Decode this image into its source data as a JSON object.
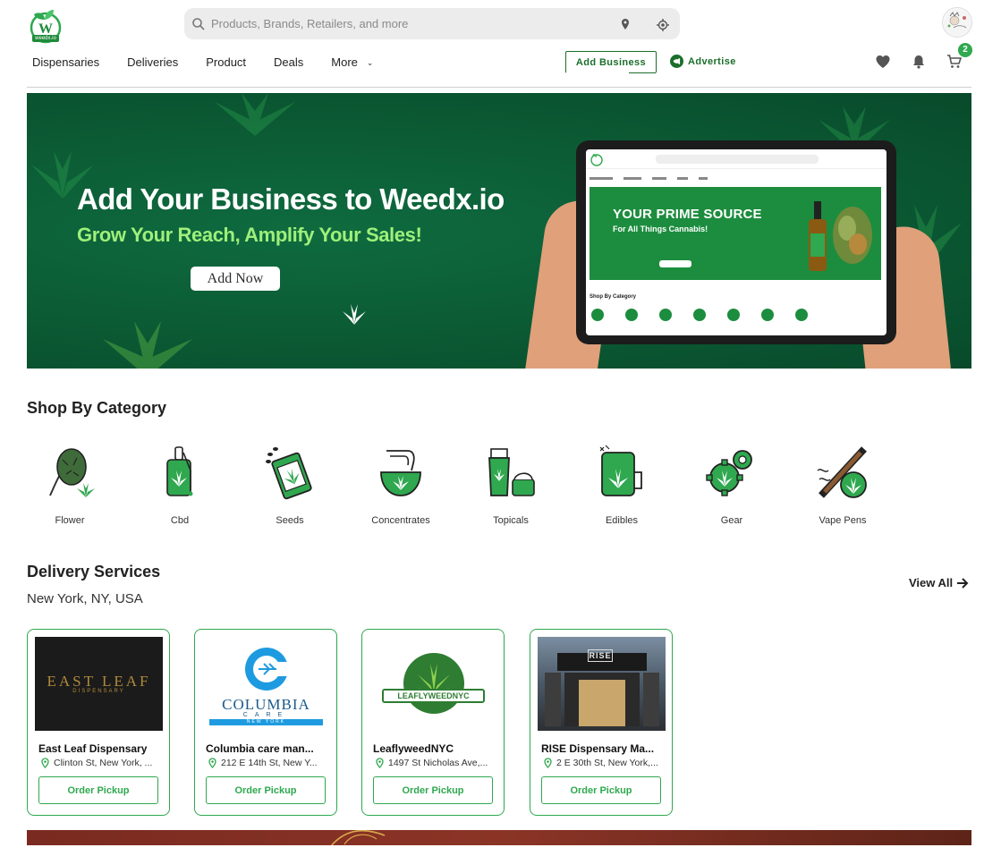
{
  "header": {
    "logo_text": "weedx.io",
    "search_placeholder": "Products, Brands, Retailers, and more",
    "nav": [
      "Dispensaries",
      "Deliveries",
      "Product",
      "Deals",
      "More"
    ],
    "add_business": "Add Business",
    "advertise": "Advertise",
    "cart_count": "2"
  },
  "banner": {
    "title": "Add Your Business to Weedx.io",
    "subtitle": "Grow Your Reach, Amplify Your Sales!",
    "button": "Add Now",
    "tablet_hero_title": "YOUR PRIME SOURCE",
    "tablet_hero_sub": "For All Things Cannabis!",
    "tablet_category": "Shop By Category"
  },
  "categories": {
    "title": "Shop By Category",
    "items": [
      "Flower",
      "Cbd",
      "Seeds",
      "Concentrates",
      "Topicals",
      "Edibles",
      "Gear",
      "Vape Pens"
    ]
  },
  "delivery": {
    "title": "Delivery Services",
    "location": "New York, NY, USA",
    "view_all": "View All",
    "cards": [
      {
        "name": "East Leaf Dispensary",
        "address": "Clinton St, New York, ...",
        "button": "Order Pickup",
        "logo_text": "EAST LEAF",
        "logo_sub": "DISPENSARY"
      },
      {
        "name": "Columbia care man...",
        "address": "212 E 14th St, New Y...",
        "button": "Order Pickup",
        "logo_text": "COLUMBIA",
        "logo_sub": "CARE",
        "logo_sub2": "NEW YORK"
      },
      {
        "name": "LeaflyweedNYC",
        "address": "1497 St Nicholas Ave,...",
        "button": "Order Pickup",
        "logo_text": "LEAFLYWEEDNYC"
      },
      {
        "name": "RISE Dispensary Ma...",
        "address": "2 E 30th St, New York,...",
        "button": "Order Pickup",
        "logo_text": "RISE"
      }
    ]
  },
  "colors": {
    "brand_green": "#2fa84f",
    "dark_green": "#1b6e2b",
    "banner_bg": "#0b5a34",
    "banner_accent": "#9ef07a"
  }
}
